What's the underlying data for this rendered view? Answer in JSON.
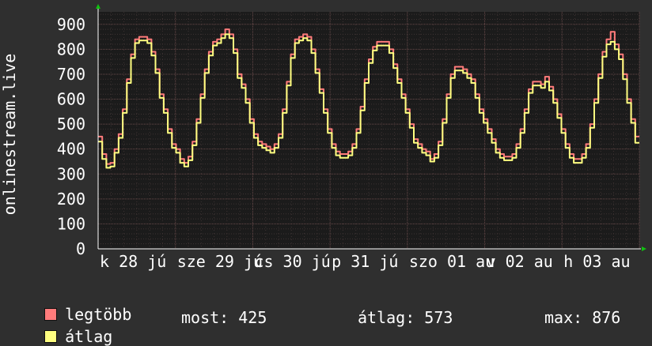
{
  "chart_data": {
    "type": "line",
    "ylabel": "onlinestream.live",
    "ylim": [
      0,
      950
    ],
    "yticks": [
      0,
      100,
      200,
      300,
      400,
      500,
      600,
      700,
      800,
      900
    ],
    "x_tick_labels": [
      "k 28 jú",
      "sze 29 jú",
      "cs 30 jú",
      "p 31 jú",
      "szo 01 au",
      "v 02 au",
      "h 03 au"
    ],
    "grid": true,
    "legend": "bottom",
    "colors": {
      "background": "#2f2f2f",
      "plot": "#1b1b1b",
      "grid_major": "#6a4b4b",
      "grid_minor": "#3e3333",
      "max_series": "#ff7b7b",
      "avg_series": "#ffff80",
      "axis": "#ffffff",
      "arrow": "#10c010"
    },
    "series": [
      {
        "name": "legtöbb",
        "values": [
          450,
          380,
          340,
          345,
          400,
          460,
          560,
          680,
          780,
          840,
          850,
          850,
          840,
          790,
          720,
          620,
          560,
          480,
          420,
          400,
          360,
          345,
          370,
          430,
          520,
          620,
          720,
          790,
          830,
          840,
          860,
          880,
          860,
          800,
          700,
          660,
          600,
          520,
          460,
          430,
          420,
          410,
          400,
          420,
          460,
          560,
          670,
          780,
          840,
          850,
          860,
          850,
          800,
          720,
          640,
          560,
          480,
          420,
          390,
          380,
          380,
          390,
          420,
          480,
          570,
          680,
          760,
          810,
          830,
          830,
          830,
          800,
          740,
          680,
          620,
          560,
          500,
          440,
          420,
          400,
          390,
          360,
          380,
          430,
          520,
          620,
          700,
          730,
          730,
          720,
          700,
          680,
          620,
          560,
          520,
          480,
          440,
          400,
          380,
          370,
          370,
          380,
          420,
          480,
          560,
          640,
          670,
          670,
          660,
          690,
          650,
          600,
          540,
          480,
          420,
          380,
          360,
          360,
          380,
          420,
          500,
          600,
          700,
          790,
          840,
          870,
          820,
          780,
          700,
          600,
          520,
          450
        ]
      },
      {
        "name": "átlag",
        "values": [
          430,
          360,
          325,
          330,
          385,
          445,
          545,
          665,
          765,
          825,
          835,
          835,
          825,
          775,
          705,
          605,
          545,
          465,
          405,
          385,
          345,
          330,
          355,
          415,
          505,
          605,
          705,
          775,
          815,
          825,
          845,
          860,
          845,
          785,
          685,
          645,
          585,
          505,
          445,
          415,
          405,
          395,
          385,
          405,
          445,
          545,
          655,
          765,
          825,
          835,
          845,
          835,
          785,
          705,
          625,
          545,
          465,
          405,
          375,
          365,
          365,
          375,
          405,
          465,
          555,
          665,
          745,
          795,
          815,
          815,
          815,
          785,
          725,
          665,
          605,
          545,
          485,
          425,
          405,
          385,
          375,
          350,
          365,
          415,
          505,
          605,
          685,
          715,
          715,
          705,
          685,
          665,
          605,
          545,
          505,
          465,
          425,
          385,
          365,
          355,
          355,
          365,
          405,
          465,
          545,
          625,
          655,
          655,
          645,
          670,
          635,
          585,
          525,
          465,
          405,
          365,
          345,
          345,
          365,
          405,
          485,
          585,
          685,
          770,
          820,
          830,
          800,
          760,
          680,
          585,
          505,
          425
        ]
      }
    ]
  },
  "legend": {
    "max_label": "legtöbb",
    "avg_label": "átlag",
    "now_stat": "most: 425",
    "avg_stat": "átlag: 573",
    "max_stat": "max: 876"
  }
}
